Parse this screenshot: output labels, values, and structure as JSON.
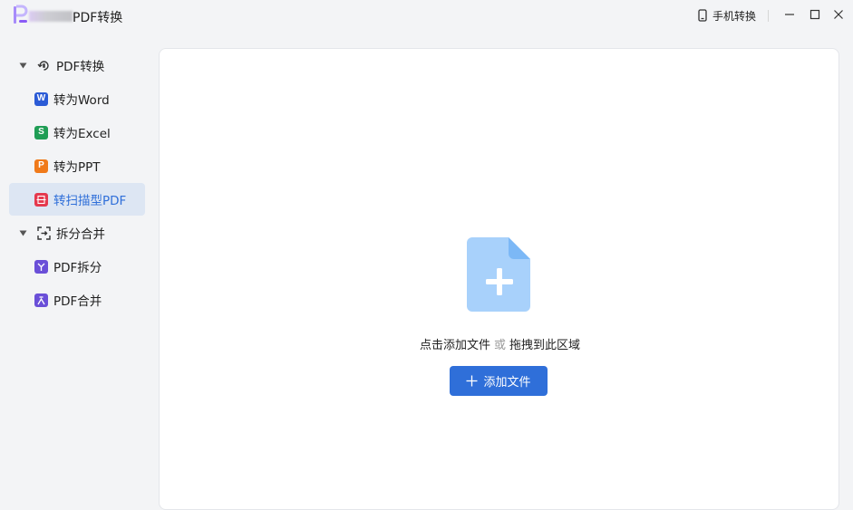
{
  "window": {
    "title": "PDF转换",
    "phone_convert_label": "手机转换"
  },
  "sidebar": {
    "groups": [
      {
        "label": "PDF转换",
        "items": [
          {
            "label": "转为Word",
            "icon_text": "W",
            "color": "#2b5bd6"
          },
          {
            "label": "转为Excel",
            "icon_text": "S",
            "color": "#1f9d55"
          },
          {
            "label": "转为PPT",
            "icon_text": "P",
            "color": "#f07a1a"
          },
          {
            "label": "转扫描型PDF",
            "icon_text": "",
            "color": "#e5384d",
            "active": true
          }
        ]
      },
      {
        "label": "拆分合并",
        "items": [
          {
            "label": "PDF拆分",
            "icon_text": "",
            "color": "#6a4fd8"
          },
          {
            "label": "PDF合并",
            "icon_text": "",
            "color": "#6a4fd8"
          }
        ]
      }
    ]
  },
  "main": {
    "drop_text_1": "点击添加文件",
    "drop_text_or": "或",
    "drop_text_2": "拖拽到此区域",
    "add_button_label": "添加文件"
  },
  "colors": {
    "accent": "#2f6fd9",
    "active_bg": "#dde6f3",
    "file_icon_light": "#a8d1fb",
    "file_icon_fold": "#7cb8f6"
  }
}
